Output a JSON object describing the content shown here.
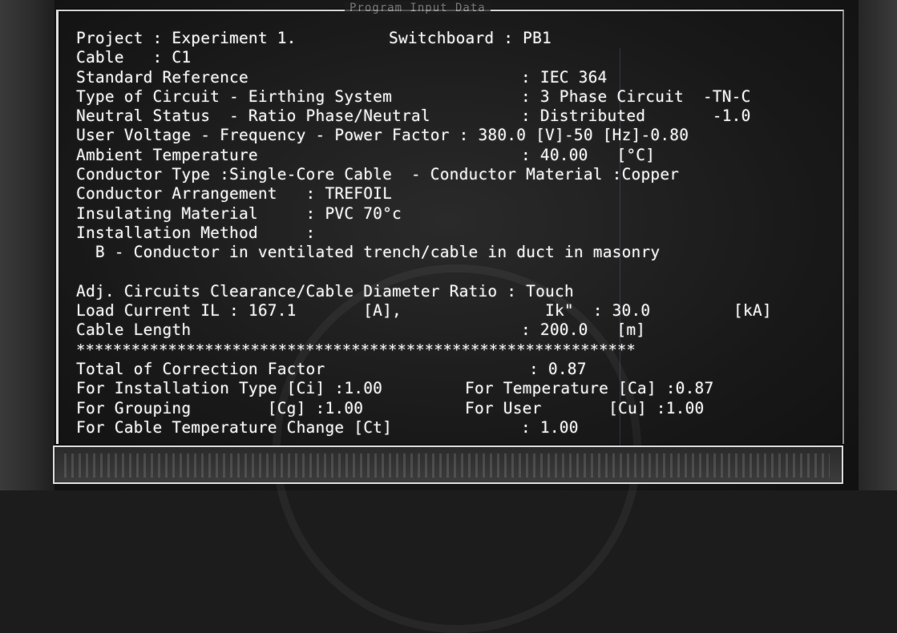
{
  "window": {
    "title": "Program Input Data"
  },
  "lines": [
    {
      "a": "Project : Experiment 1.",
      "b": "Switchboard : PB1",
      "c": ""
    },
    {
      "a": "Cable   : C1",
      "b": "",
      "c": ""
    },
    {
      "a": "Standard Reference",
      "b": "",
      "c": ": IEC 364"
    },
    {
      "a": "Type of Circuit - Eirthing System",
      "b": "",
      "c": ": 3 Phase Circuit  -TN-C"
    },
    {
      "a": "Neutral Status  - Ratio Phase/Neutral",
      "b": "",
      "c": ": Distributed       -1.0"
    },
    {
      "a": "User Voltage - Frequency - Power Factor : 380.0 [V]-50 [Hz]-0.80",
      "b": "",
      "c": ""
    },
    {
      "a": "Ambient Temperature",
      "b": "",
      "c": ": 40.00   [°C]"
    },
    {
      "a": "Conductor Type :Single-Core Cable  - Conductor Material :Copper",
      "b": "",
      "c": ""
    },
    {
      "a": "Conductor Arrangement   : TREFOIL",
      "b": "",
      "c": ""
    },
    {
      "a": "Insulating Material     : PVC 70°c",
      "b": "",
      "c": ""
    },
    {
      "a": "Installation Method     :",
      "b": "",
      "c": ""
    },
    {
      "a": "  B - Conductor in ventilated trench/cable in duct in masonry",
      "b": "",
      "c": ""
    },
    {
      "a": "",
      "b": "",
      "c": ""
    },
    {
      "a": "Adj. Circuits Clearance/Cable Diameter Ratio : Touch",
      "b": "",
      "c": ""
    },
    {
      "a": "Load Current IL : 167.1       [A],",
      "b": "Ik\"  : 30.0",
      "c": "[kA]"
    },
    {
      "a": "Cable Length",
      "b": "",
      "c": ": 200.0   [m]"
    },
    {
      "a": "*************************************************************",
      "b": "",
      "c": ""
    },
    {
      "a": "Total of Correction Factor",
      "b": "",
      "c": ": 0.87"
    },
    {
      "a": "For Installation Type [Ci] :1.00",
      "b": "For Temperature [Ca] :0.87",
      "c": ""
    },
    {
      "a": "For Grouping        [Cg] :1.00",
      "b": "For User       [Cu] :1.00",
      "c": ""
    },
    {
      "a": "For Cable Temperature Change [Ct]",
      "b": "",
      "c": ": 1.00"
    }
  ]
}
